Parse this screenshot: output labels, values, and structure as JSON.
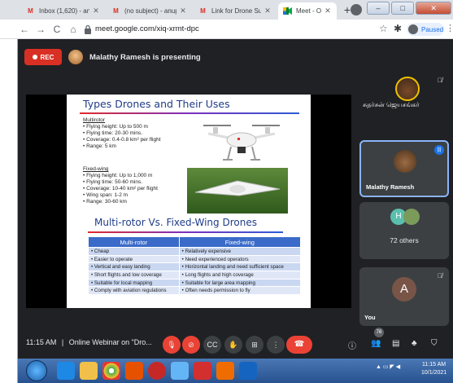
{
  "browser": {
    "tabs": [
      {
        "label": "Inbox (1,620) - anupriya...",
        "icon": "gmail-icon"
      },
      {
        "label": "(no subject) - anupriyan...",
        "icon": "gmail-icon"
      },
      {
        "label": "Link for Drone Surveying...",
        "icon": "gmail-icon"
      },
      {
        "label": "Meet - Online Webi...",
        "icon": "meet-icon",
        "active": true
      }
    ],
    "url": "meet.google.com/xiq-xrmt-dpc",
    "profile_status": "Paused"
  },
  "meet": {
    "rec_label": "REC",
    "presenting_text": "Malathy Ramesh is presenting",
    "tiles": [
      {
        "name": "சுதர்சன் ஜெயசங்கர்",
        "muted": true
      },
      {
        "name": "Malathy Ramesh",
        "speaking": true
      },
      {
        "initial": "H",
        "name": "72 others"
      },
      {
        "initial": "A",
        "name": "You",
        "muted": true
      }
    ],
    "time": "11:15 AM",
    "separator": "|",
    "meeting_title": "Online Webinar on \"Dro...",
    "people_count": "76"
  },
  "slide": {
    "title": "Types Drones and Their Uses",
    "multirotor": {
      "heading": "Multirotor",
      "items": [
        "Flying height: Up to 500 m",
        "Flying time: 20-30 mins.",
        "Coverage: 0.4-0.8 km² per flight",
        "Range: 5 km"
      ]
    },
    "fixedwing": {
      "heading": "Fixed-wing",
      "items": [
        "Flying height: Up to 1,000 m",
        "Flying time: 50-60 mins.",
        "Coverage: 10-40 km² per flight",
        "Wing span: 1-2 m",
        "Range: 30-60 km"
      ]
    },
    "comparison_title": "Multi-rotor Vs. Fixed-Wing Drones",
    "table": {
      "headers": [
        "Multi-rotor",
        "Fixed-wing"
      ],
      "rows": [
        [
          "Cheap",
          "Relatively expensive"
        ],
        [
          "Easier to operate",
          "Need experienced operators"
        ],
        [
          "Vertical and easy landing",
          "Horizontal landing and need sufficient space"
        ],
        [
          "Short flights and low coverage",
          "Long flights and high coverage"
        ],
        [
          "Suitable for local mapping",
          "Suitable for large area mapping"
        ],
        [
          "Comply with aviation regulations",
          "Often needs permission to fly"
        ]
      ]
    }
  },
  "taskbar": {
    "clock_time": "11:15 AM",
    "clock_date": "10/1/2021"
  }
}
